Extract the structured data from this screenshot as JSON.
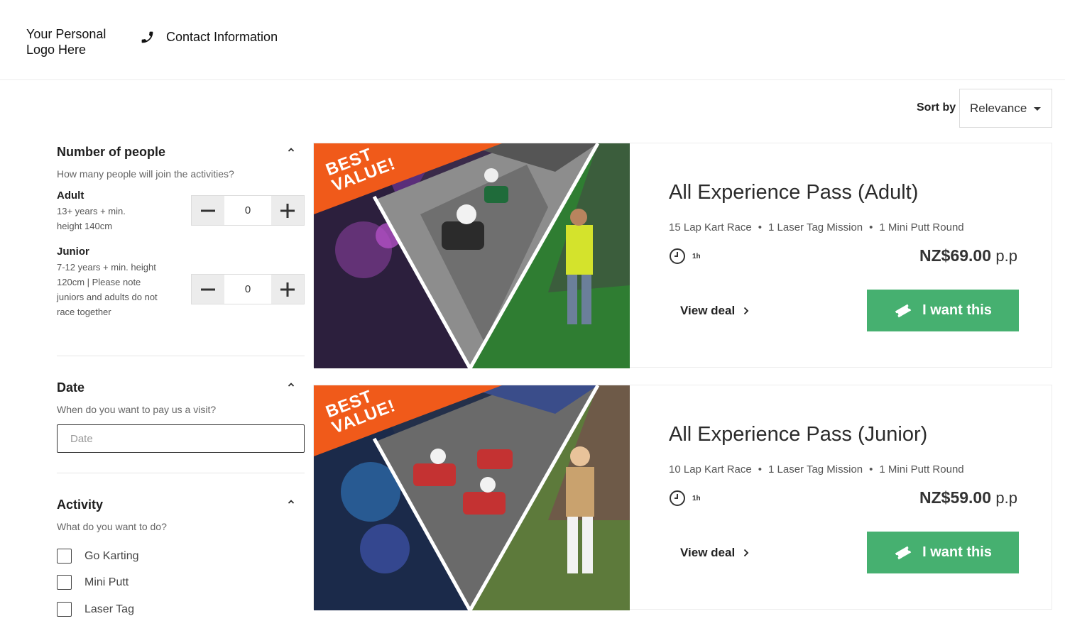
{
  "header": {
    "logo_text": "Your Personal Logo Here",
    "contact_text": "Contact Information"
  },
  "sort": {
    "label": "Sort by",
    "selected": "Relevance"
  },
  "filters": {
    "people": {
      "title": "Number of people",
      "subtitle": "How many people will join the activities?",
      "adult": {
        "label": "Adult",
        "desc": "13+ years + min. height 140cm",
        "value": "0"
      },
      "junior": {
        "label": "Junior",
        "desc": "7-12 years + min. height 120cm | Please note juniors and adults do not race together",
        "value": "0"
      }
    },
    "date": {
      "title": "Date",
      "subtitle": "When do you want to pay us a visit?",
      "placeholder": "Date"
    },
    "activity": {
      "title": "Activity",
      "subtitle": "What do you want to do?",
      "options": [
        "Go Karting",
        "Mini Putt",
        "Laser Tag"
      ]
    }
  },
  "deals": [
    {
      "badge": "BEST VALUE!",
      "title": "All Experience Pass (Adult)",
      "features": [
        "15 Lap Kart Race",
        "1 Laser Tag Mission",
        "1 Mini Putt Round"
      ],
      "duration": "1h",
      "price": "NZ$69.00",
      "price_unit": "p.p",
      "view_label": "View deal",
      "cta_label": "I want this"
    },
    {
      "badge": "BEST VALUE!",
      "title": "All Experience Pass (Junior)",
      "features": [
        "10 Lap Kart Race",
        "1 Laser Tag Mission",
        "1 Mini Putt Round"
      ],
      "duration": "1h",
      "price": "NZ$59.00",
      "price_unit": "p.p",
      "view_label": "View deal",
      "cta_label": "I want this"
    }
  ],
  "colors": {
    "cta": "#46b070",
    "badge": "#f05a1a"
  }
}
